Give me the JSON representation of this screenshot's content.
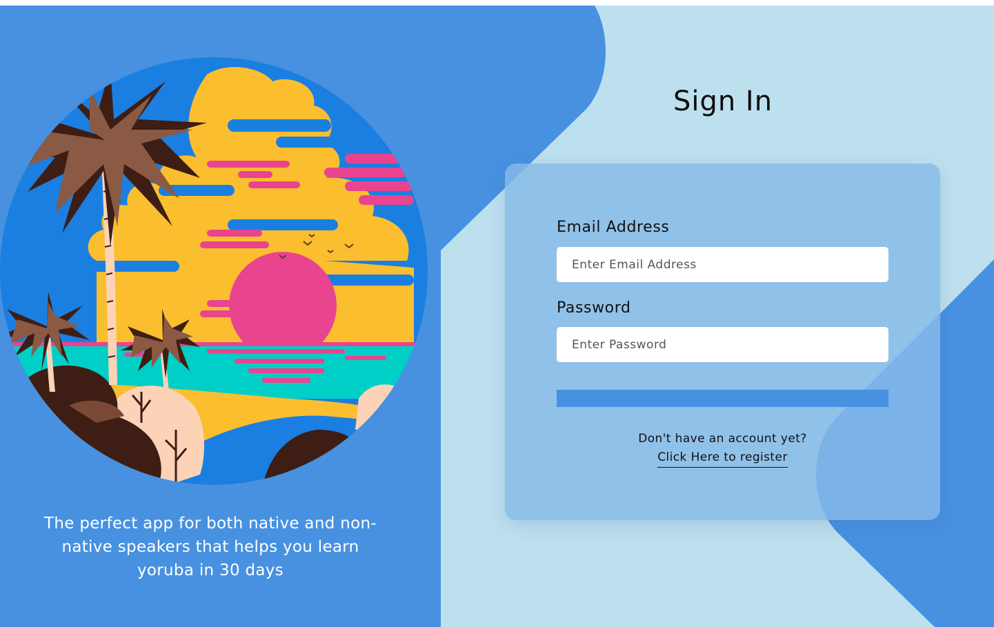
{
  "tagline": "The perfect app for both native and non-native speakers that helps you learn yoruba in 30 days",
  "signin": {
    "title": "Sign In",
    "email_label": "Email Address",
    "email_placeholder": "Enter Email Address",
    "email_value": "",
    "password_label": "Password",
    "password_placeholder": "Enter Password",
    "password_value": "",
    "submit_label": "",
    "register_prompt": "Don't have an account yet?",
    "register_link": "Click Here to register"
  },
  "colors": {
    "brand_blue": "#4791e0",
    "light_blue_bg": "#bde0ef",
    "card": "#8dbde8",
    "sun_pink": "#e8448f",
    "sky_yellow": "#fbbe2e",
    "sea_teal": "#00cfc8",
    "palm_brown": "#8a5a44"
  }
}
